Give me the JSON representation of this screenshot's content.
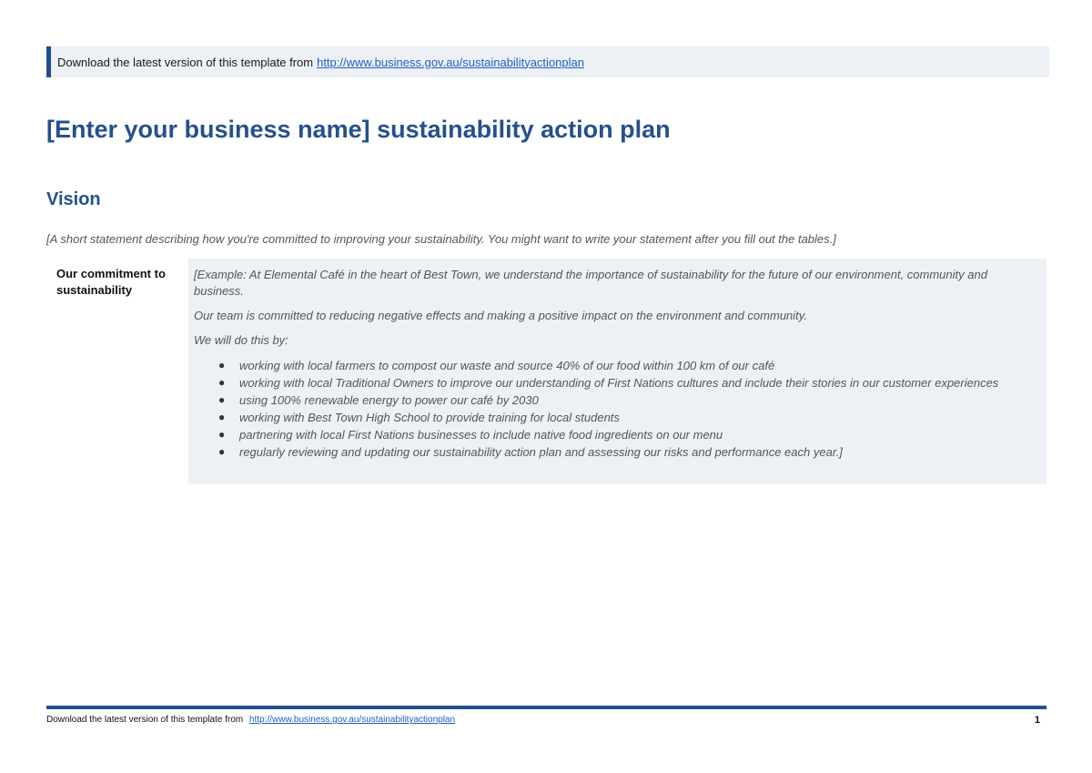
{
  "banner": {
    "text": "Download the latest version of this template from",
    "link": "http://www.business.gov.au/sustainabilityactionplan"
  },
  "title": "[Enter your business name] sustainability action plan",
  "vision": {
    "heading": "Vision",
    "intro": "[A short statement describing how you're committed to improving your sustainability. You might want to write your statement after you fill out the tables.]"
  },
  "commitment": {
    "label": "Our commitment to sustainability",
    "paragraphs": [
      "[Example: At Elemental Café in the heart of Best Town, we understand the importance of sustainability for the future of our environment, community and business.",
      "Our team is committed to reducing negative effects and making a positive impact on the environment and community.",
      "We will do this by:"
    ],
    "items": [
      "working with local farmers to compost our waste and source 40% of our food within 100 km of our café",
      "working with local Traditional Owners to improve our understanding of First Nations cultures and include their stories in our customer experiences",
      "using 100% renewable energy to power our café by 2030",
      "working with Best Town High School to provide training for local students",
      "partnering with local First Nations businesses to include native food ingredients on our menu",
      "regularly reviewing and updating our sustainability action plan and assessing our risks and performance each year.]"
    ]
  },
  "footer": {
    "text": "Download the latest version of this template from",
    "link": "http://www.business.gov.au/sustainabilityactionplan",
    "page_number": "1"
  }
}
